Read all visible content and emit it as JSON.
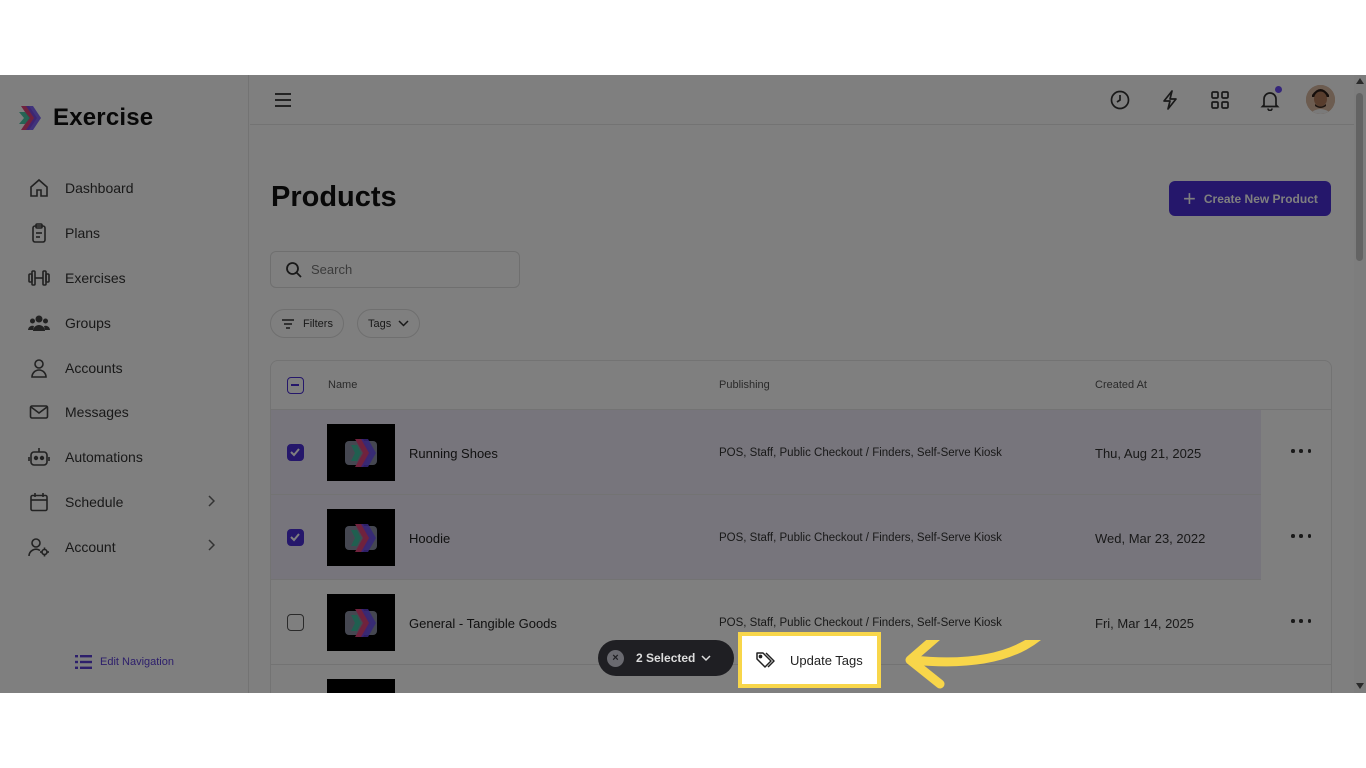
{
  "brand": {
    "name": "Exercise"
  },
  "sidebar": {
    "items": [
      {
        "label": "Dashboard",
        "icon": "home-icon"
      },
      {
        "label": "Plans",
        "icon": "clipboard-icon"
      },
      {
        "label": "Exercises",
        "icon": "dumbbell-icon"
      },
      {
        "label": "Groups",
        "icon": "users-icon"
      },
      {
        "label": "Accounts",
        "icon": "user-icon"
      },
      {
        "label": "Messages",
        "icon": "mail-icon"
      },
      {
        "label": "Automations",
        "icon": "robot-icon"
      },
      {
        "label": "Schedule",
        "icon": "calendar-icon",
        "has_submenu": true
      },
      {
        "label": "Account",
        "icon": "user-settings-icon",
        "has_submenu": true
      }
    ],
    "edit_navigation": "Edit Navigation"
  },
  "topbar": {
    "icons": [
      "menu-icon",
      "clock-icon",
      "lightning-icon",
      "apps-grid-icon",
      "bell-icon",
      "avatar"
    ]
  },
  "page": {
    "title": "Products",
    "create_button": "Create New Product",
    "search_placeholder": "Search",
    "filters_label": "Filters",
    "tags_label": "Tags"
  },
  "table": {
    "columns": [
      "Name",
      "Publishing",
      "Created At"
    ],
    "rows": [
      {
        "name": "Running Shoes",
        "publishing": "POS, Staff, Public Checkout / Finders, Self-Serve Kiosk",
        "created_at": "Thu, Aug 21, 2025",
        "selected": true
      },
      {
        "name": "Hoodie",
        "publishing": "POS, Staff, Public Checkout / Finders, Self-Serve Kiosk",
        "created_at": "Wed, Mar 23, 2022",
        "selected": true
      },
      {
        "name": "General - Tangible Goods",
        "publishing": "POS, Staff, Public Checkout / Finders, Self-Serve Kiosk",
        "created_at": "Fri, Mar 14, 2025",
        "selected": false
      }
    ]
  },
  "bulk_actions": {
    "selected_label": "2 Selected",
    "update_tags": "Update Tags"
  },
  "colors": {
    "accent": "#4b2fd6",
    "highlight": "#f8d64a",
    "overlay": "rgba(0,0,0,0.5)"
  }
}
